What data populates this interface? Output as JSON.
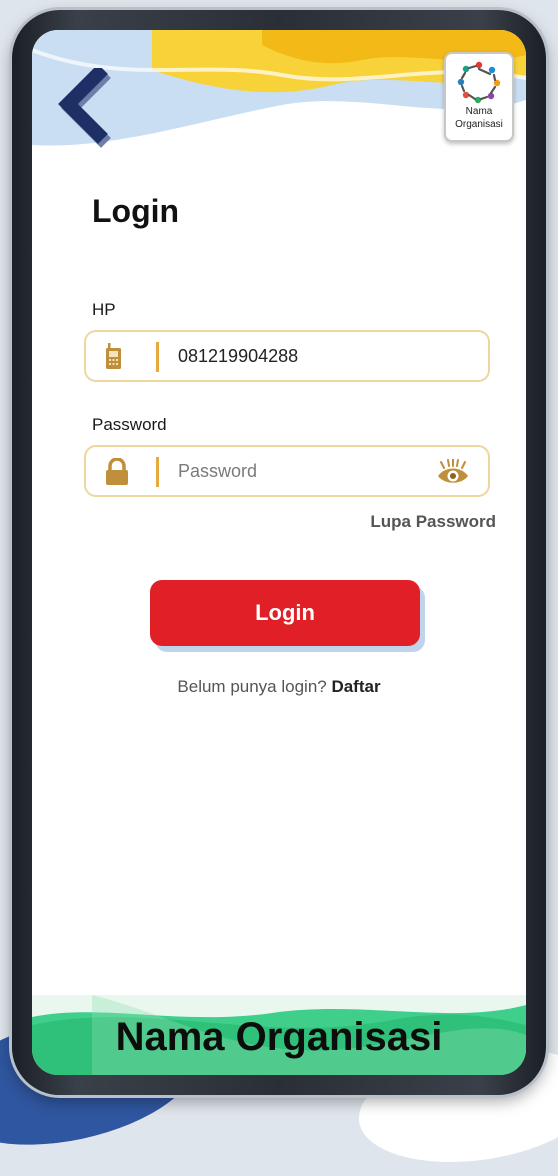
{
  "header": {
    "back_icon": "chevron-left-icon",
    "logo": {
      "text_line1": "Nama",
      "text_line2": "Organisasi"
    }
  },
  "page": {
    "title": "Login"
  },
  "form": {
    "phone": {
      "label": "HP",
      "value": "081219904288",
      "icon": "phone-icon"
    },
    "password": {
      "label": "Password",
      "placeholder": "Password",
      "value": "",
      "icon": "lock-icon",
      "toggle_icon": "eye-icon"
    },
    "forgot_label": "Lupa Password",
    "submit_label": "Login"
  },
  "register": {
    "prompt": "Belum punya login? ",
    "link_label": "Daftar"
  },
  "footer": {
    "title": "Nama Organisasi"
  },
  "colors": {
    "primary_red": "#e01f26",
    "field_border": "#eed79e",
    "icon_gold": "#c08f3b",
    "divider_orange": "#e7a93e",
    "header_yellow": "#f3c316",
    "header_blue": "#b9d6f1",
    "footer_green": "#3fcf8a",
    "back_navy": "#1e2f66"
  }
}
